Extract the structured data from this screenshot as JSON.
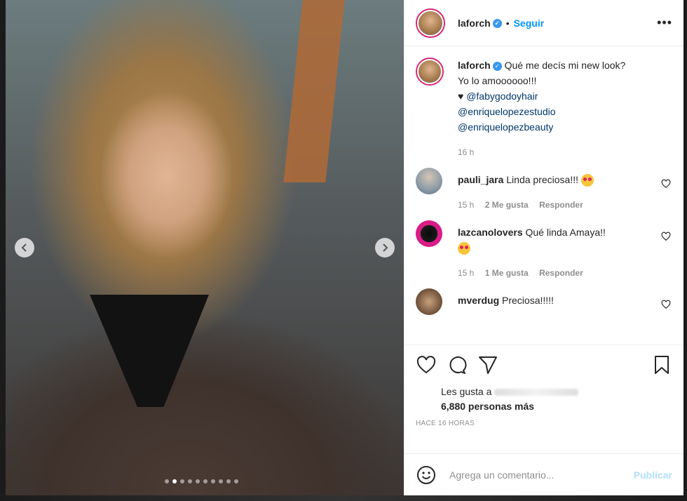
{
  "post": {
    "username": "laforch",
    "follow_label": "Seguir",
    "separator": "•",
    "more_label": "•••",
    "carousel": {
      "total_images": 10,
      "active_index": 1
    }
  },
  "caption": {
    "username": "laforch",
    "text_line1": "Qué me decís mi new look?",
    "text_line2": "Yo lo amoooooo!!!",
    "heart": "♥",
    "mentions": [
      "@fabygodoyhair",
      "@enriquelopezestudio",
      "@enriquelopezbeauty"
    ],
    "time": "16 h"
  },
  "comments": [
    {
      "username": "pauli_jara",
      "text": "Linda preciosa!!!",
      "emoji": true,
      "time": "15 h",
      "likes": "2 Me gusta",
      "reply": "Responder"
    },
    {
      "username": "lazcanolovers",
      "text": "Qué linda Amaya!!",
      "emoji": true,
      "time": "15 h",
      "likes": "1 Me gusta",
      "reply": "Responder"
    },
    {
      "username": "mverdug",
      "text": "Preciosa!!!!!",
      "emoji": false
    }
  ],
  "likes": {
    "prefix": "Les gusta a",
    "count_text": "6,880 personas más"
  },
  "time_ago": "HACE 16 HORAS",
  "add_comment": {
    "placeholder": "Agrega un comentario...",
    "publish_label": "Publicar"
  },
  "colors": {
    "accent": "#0095f6",
    "verified": "#3897f0",
    "publish_disabled": "#b2dffc"
  }
}
